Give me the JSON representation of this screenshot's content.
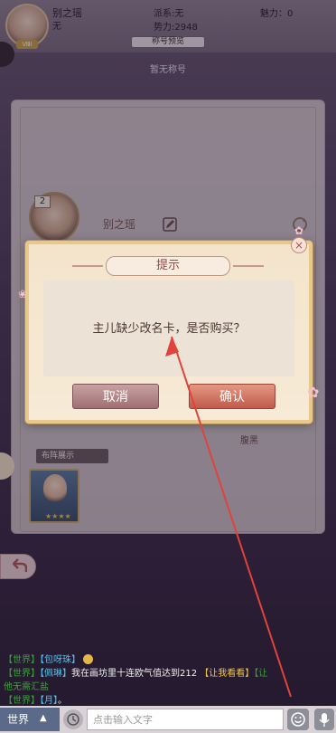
{
  "header": {
    "player_name": "别之瑶",
    "sect_label": "派系:无",
    "charm_label": "魅力：0",
    "title_value": "无",
    "power_label": "势力:2948",
    "title_preview_button": "称号预览",
    "no_title_text": "暂无称号",
    "avatar_badge": "ⅧⅠ"
  },
  "profile": {
    "level": "2",
    "name": "别之瑶",
    "formation_label": "布阵展示",
    "card_stars": "★★★★",
    "partial_label": "腹黑"
  },
  "dialog": {
    "title": "提示",
    "message": "主儿缺少改名卡，是否购买？",
    "cancel_label": "取消",
    "confirm_label": "确认",
    "close_label": "×"
  },
  "chat": {
    "lines": [
      {
        "channel": "【世界】",
        "name": "【包呀珠】",
        "text": ""
      },
      {
        "channel": "【世界】",
        "name": "【佩琳】",
        "text": "我在画坊里十连欧气值达到212",
        "link": "【让我看看】",
        "extra": "【让"
      },
      {
        "channel": "",
        "name": "",
        "text": "他无需汇盐"
      },
      {
        "channel": "【世界】",
        "name": "【月】",
        "text": "。"
      }
    ],
    "channel_selector": "世界",
    "input_placeholder": "点击输入文字"
  },
  "colors": {
    "confirm_button": "#c05a4b",
    "cancel_button": "#9f6f72",
    "dialog_border": "#e8c98d",
    "annotation_arrow": "#e0433b"
  }
}
